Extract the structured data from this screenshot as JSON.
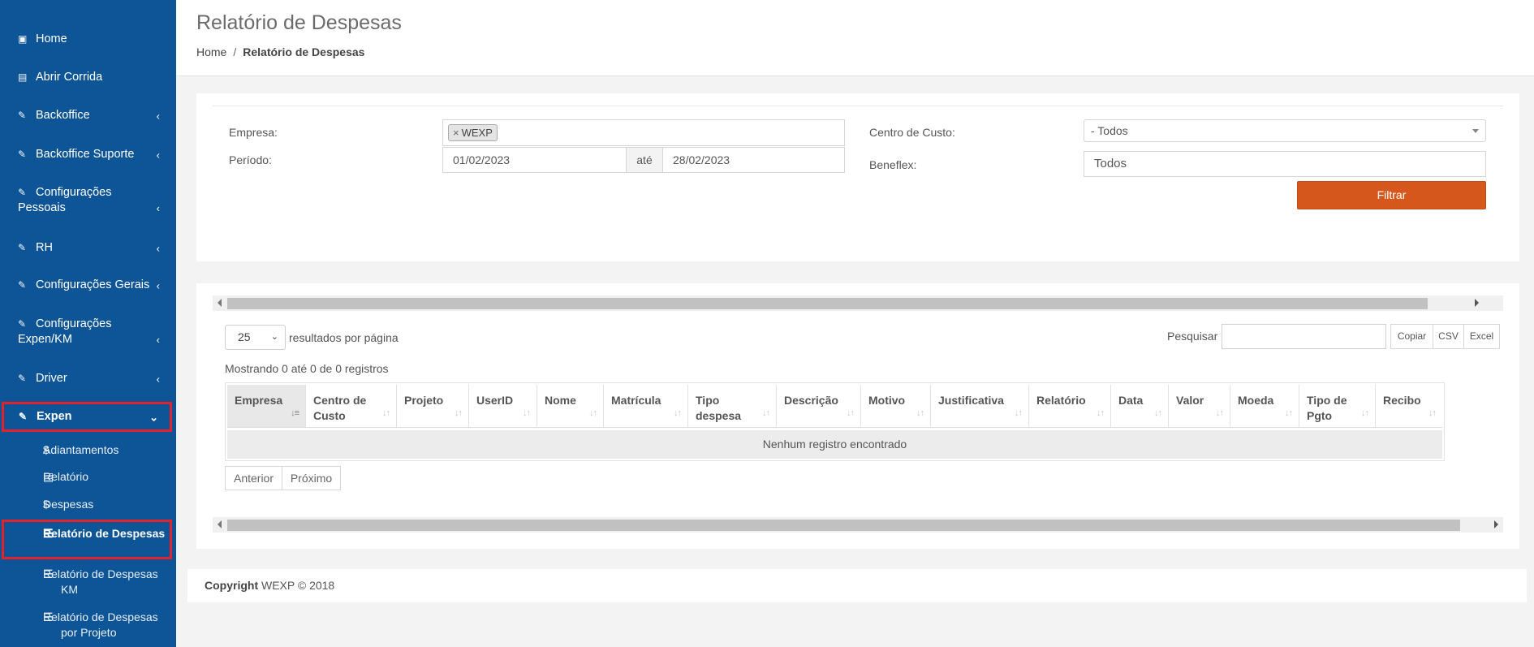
{
  "sidebar": {
    "items": [
      {
        "label": "Home",
        "icon": "laptop-icon"
      },
      {
        "label": "Abrir Corrida",
        "icon": "calendar-icon"
      },
      {
        "label": "Backoffice",
        "icon": "edit-icon"
      },
      {
        "label": "Backoffice Suporte",
        "icon": "edit-icon"
      },
      {
        "label": "Configurações",
        "label2": "Pessoais",
        "icon": "edit-icon"
      },
      {
        "label": "RH",
        "icon": "edit-icon"
      },
      {
        "label": "Configurações Gerais",
        "icon": "edit-icon"
      },
      {
        "label": "Configurações",
        "label2": "Expen/KM",
        "icon": "edit-icon"
      },
      {
        "label": "Driver",
        "icon": "edit-icon"
      },
      {
        "label": "Expen",
        "icon": "edit-icon"
      }
    ],
    "sub_items": [
      {
        "label": "Adiantamentos",
        "icon": "dollar-icon"
      },
      {
        "label": "Relatório",
        "icon": "report-icon"
      },
      {
        "label": "Despesas",
        "icon": "dollar-icon"
      },
      {
        "label": "Relatório de Despesas",
        "icon": "list-icon"
      },
      {
        "label": "Relatório de Despesas KM",
        "icon": "list-icon"
      },
      {
        "label": "Relatório de Despesas por Projeto",
        "icon": "list-icon"
      }
    ]
  },
  "header": {
    "title": "Relatório de Despesas",
    "breadcrumb": {
      "home": "Home",
      "separator": "/",
      "current": "Relatório de Despesas"
    }
  },
  "filters": {
    "empresa_label": "Empresa:",
    "empresa_tag": "WEXP",
    "empresa_tag_remove": "×",
    "periodo_label": "Período:",
    "date_from": "01/02/2023",
    "date_sep": "até",
    "date_to": "28/02/2023",
    "centro_label": "Centro de Custo:",
    "centro_value": "- Todos",
    "beneflex_label": "Beneflex:",
    "beneflex_value": "Todos",
    "filter_button": "Filtrar"
  },
  "table_controls": {
    "page_length": "25",
    "page_length_label": "resultados por página",
    "search_label": "Pesquisar",
    "search_value": "",
    "export_buttons": [
      "Copiar",
      "CSV",
      "Excel"
    ],
    "info": "Mostrando 0 até 0 de 0 registros",
    "prev": "Anterior",
    "next": "Próximo"
  },
  "table": {
    "columns": [
      {
        "l1": "Empresa",
        "l2": ""
      },
      {
        "l1": "Centro de",
        "l2": "Custo"
      },
      {
        "l1": "Projeto",
        "l2": ""
      },
      {
        "l1": "UserID",
        "l2": ""
      },
      {
        "l1": "Nome",
        "l2": ""
      },
      {
        "l1": "Matrícula",
        "l2": ""
      },
      {
        "l1": "Tipo",
        "l2": "despesa"
      },
      {
        "l1": "Descrição",
        "l2": ""
      },
      {
        "l1": "Motivo",
        "l2": ""
      },
      {
        "l1": "Justificativa",
        "l2": ""
      },
      {
        "l1": "Relatório",
        "l2": ""
      },
      {
        "l1": "Data",
        "l2": ""
      },
      {
        "l1": "Valor",
        "l2": ""
      },
      {
        "l1": "Moeda",
        "l2": ""
      },
      {
        "l1": "Tipo de",
        "l2": "Pgto"
      },
      {
        "l1": "Recibo",
        "l2": ""
      }
    ],
    "empty_message": "Nenhum registro encontrado"
  },
  "footer": {
    "copyright_label": "Copyright",
    "copyright_text": "WEXP © 2018"
  },
  "colors": {
    "sidebar": "#0e5597",
    "accent": "#d6571c",
    "highlight": "#e3222c"
  }
}
